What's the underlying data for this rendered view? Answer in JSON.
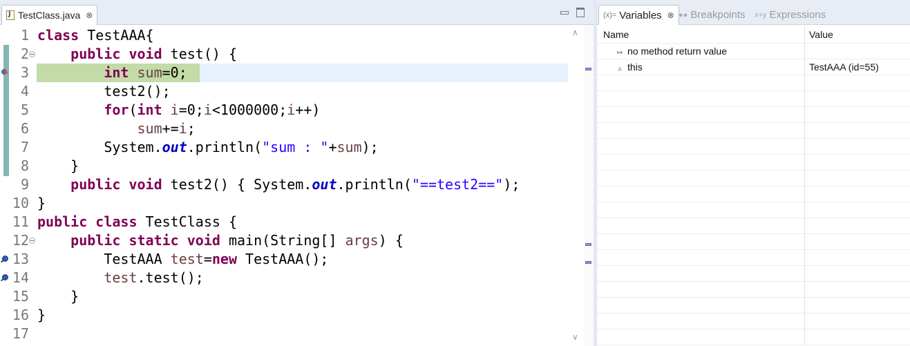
{
  "editor": {
    "tab_label": "TestClass.java",
    "tab_close": "⊗",
    "lines": [
      {
        "num": "1",
        "tokens": [
          [
            "kw",
            "class"
          ],
          [
            "plain",
            " TestAAA{"
          ]
        ]
      },
      {
        "num": "2",
        "tokens": [
          [
            "plain",
            "    "
          ],
          [
            "kw",
            "public"
          ],
          [
            "plain",
            " "
          ],
          [
            "kw",
            "void"
          ],
          [
            "plain",
            " test() {"
          ]
        ]
      },
      {
        "num": "3",
        "tokens": [
          [
            "plain",
            "        "
          ],
          [
            "kw",
            "int"
          ],
          [
            "plain",
            " "
          ],
          [
            "var",
            "sum"
          ],
          [
            "plain",
            "=0;"
          ]
        ]
      },
      {
        "num": "4",
        "tokens": [
          [
            "plain",
            "        test2();"
          ]
        ]
      },
      {
        "num": "5",
        "tokens": [
          [
            "plain",
            "        "
          ],
          [
            "kw",
            "for"
          ],
          [
            "plain",
            "("
          ],
          [
            "kw",
            "int"
          ],
          [
            "plain",
            " "
          ],
          [
            "var",
            "i"
          ],
          [
            "plain",
            "=0;"
          ],
          [
            "var",
            "i"
          ],
          [
            "plain",
            "<1000000;"
          ],
          [
            "var",
            "i"
          ],
          [
            "plain",
            "++)"
          ]
        ]
      },
      {
        "num": "6",
        "tokens": [
          [
            "plain",
            "            "
          ],
          [
            "var",
            "sum"
          ],
          [
            "plain",
            "+="
          ],
          [
            "var",
            "i"
          ],
          [
            "plain",
            ";"
          ]
        ]
      },
      {
        "num": "7",
        "tokens": [
          [
            "plain",
            "        System."
          ],
          [
            "fld",
            "out"
          ],
          [
            "plain",
            ".println("
          ],
          [
            "str",
            "\"sum : \""
          ],
          [
            "plain",
            "+"
          ],
          [
            "var",
            "sum"
          ],
          [
            "plain",
            ");"
          ]
        ]
      },
      {
        "num": "8",
        "tokens": [
          [
            "plain",
            "    }"
          ]
        ]
      },
      {
        "num": "9",
        "tokens": [
          [
            "plain",
            "    "
          ],
          [
            "kw",
            "public"
          ],
          [
            "plain",
            " "
          ],
          [
            "kw",
            "void"
          ],
          [
            "plain",
            " test2() { System."
          ],
          [
            "fld",
            "out"
          ],
          [
            "plain",
            ".println("
          ],
          [
            "str",
            "\"==test2==\""
          ],
          [
            "plain",
            ");"
          ]
        ]
      },
      {
        "num": "10",
        "tokens": [
          [
            "plain",
            "}"
          ]
        ]
      },
      {
        "num": "11",
        "tokens": [
          [
            "kw",
            "public"
          ],
          [
            "plain",
            " "
          ],
          [
            "kw",
            "class"
          ],
          [
            "plain",
            " TestClass {"
          ]
        ]
      },
      {
        "num": "12",
        "tokens": [
          [
            "plain",
            "    "
          ],
          [
            "kw",
            "public"
          ],
          [
            "plain",
            " "
          ],
          [
            "kw",
            "static"
          ],
          [
            "plain",
            " "
          ],
          [
            "kw",
            "void"
          ],
          [
            "plain",
            " main(String[] "
          ],
          [
            "var",
            "args"
          ],
          [
            "plain",
            ") {"
          ]
        ]
      },
      {
        "num": "13",
        "tokens": [
          [
            "plain",
            "        TestAAA "
          ],
          [
            "var",
            "test"
          ],
          [
            "plain",
            "="
          ],
          [
            "kw",
            "new"
          ],
          [
            "plain",
            " TestAAA();"
          ]
        ]
      },
      {
        "num": "14",
        "tokens": [
          [
            "plain",
            "        "
          ],
          [
            "var",
            "test"
          ],
          [
            "plain",
            ".test();"
          ]
        ]
      },
      {
        "num": "15",
        "tokens": [
          [
            "plain",
            "    }"
          ]
        ]
      },
      {
        "num": "16",
        "tokens": [
          [
            "plain",
            "}"
          ]
        ]
      },
      {
        "num": "17",
        "tokens": [
          [
            "plain",
            ""
          ]
        ]
      }
    ],
    "current_line": 3,
    "fold_lines": [
      2,
      12
    ],
    "breakpoint_lines": [
      13,
      14
    ],
    "ip_line": 3
  },
  "variables_view": {
    "tabs": [
      {
        "label": "Variables",
        "icon": "(x)=",
        "close": "⊗"
      },
      {
        "label": "Breakpoints",
        "icon": "●●"
      },
      {
        "label": "Expressions",
        "icon": "x+y"
      }
    ],
    "columns": {
      "name": "Name",
      "value": "Value"
    },
    "rows": [
      {
        "icon": "↦",
        "name": "no method return value",
        "value": ""
      },
      {
        "icon": "▵",
        "name": "this",
        "value": "TestAAA  (id=55)"
      }
    ]
  },
  "colors": {
    "keyword": "#7f0055",
    "string": "#2a00ff",
    "field": "#0000c0",
    "local_var": "#6a3e3e",
    "exec_highlight": "#c3dba7",
    "current_line": "#e8f2fe"
  }
}
